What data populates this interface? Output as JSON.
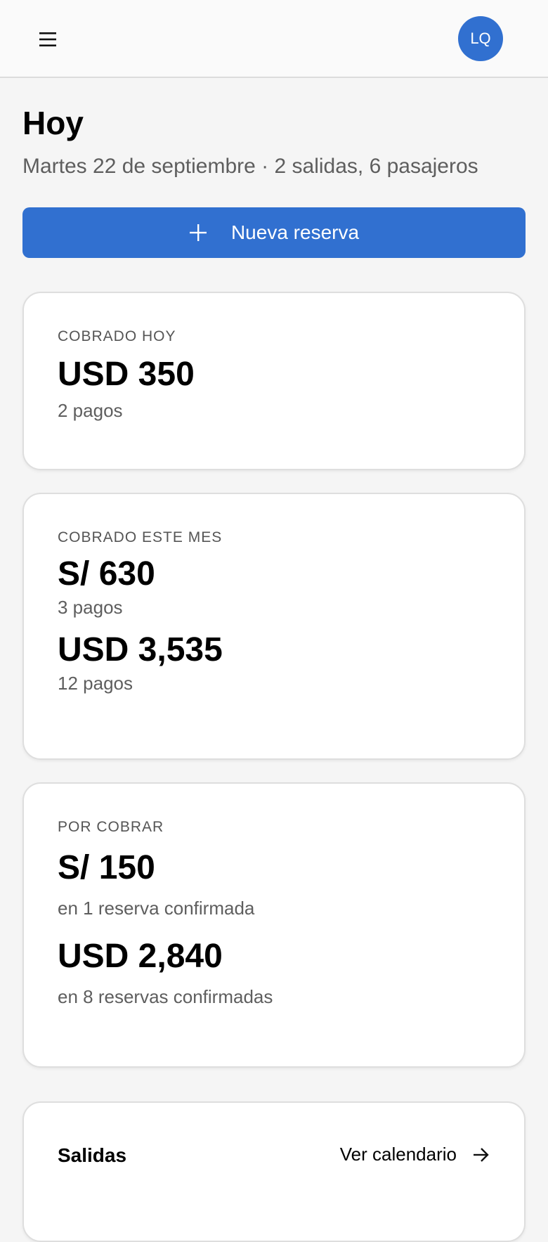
{
  "header": {
    "menu_icon": "hamburger-menu-icon",
    "avatar_initials": "LQ",
    "accent_color": "#3170d0"
  },
  "today": {
    "title": "Hoy",
    "subtitle": "Martes 22 de septiembre · 2 salidas, 6 pasajeros",
    "new_booking_label": "Nueva reserva",
    "new_booking_icon": "plus-icon"
  },
  "collected_today": {
    "label": "COBRADO HOY",
    "amount": "USD 350",
    "detail": "2 pagos"
  },
  "collected_month": {
    "label": "COBRADO ESTE MES",
    "entries": [
      {
        "amount": "S/ 630",
        "detail": "3 pagos"
      },
      {
        "amount": "USD 3,535",
        "detail": "12 pagos"
      }
    ]
  },
  "pending": {
    "label": "POR COBRAR",
    "entries": [
      {
        "amount": "S/ 150",
        "detail": "en 1 reserva confirmada"
      },
      {
        "amount": "USD 2,840",
        "detail": "en 8 reservas confirmadas"
      }
    ]
  },
  "departures": {
    "title": "Salidas",
    "calendar_link": "Ver calendario",
    "calendar_icon": "arrow-right-icon"
  }
}
